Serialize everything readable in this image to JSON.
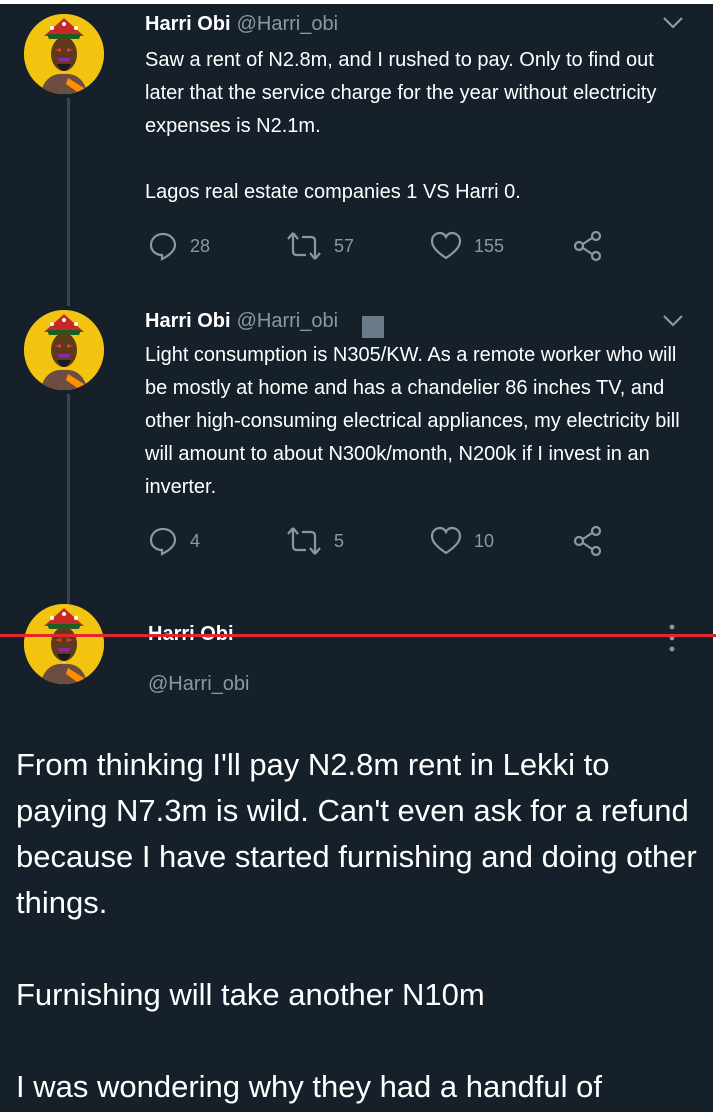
{
  "colors": {
    "background": "#15202b",
    "text": "#ffffff",
    "muted": "#8899a6",
    "thread_line": "#38444d",
    "avatar_bg": "#f2c410",
    "highlight_line": "#e0282e"
  },
  "tweets": [
    {
      "name": "Harri Obi",
      "handle": "@Harri_obi",
      "text": "Saw a rent of N2.8m, and I rushed to pay. Only to find out later that the service charge for the year without electricity expenses is N2.1m.\n\nLagos real estate companies 1 VS Harri 0.",
      "replies": "28",
      "retweets": "57",
      "likes": "155",
      "icons": [
        "chevron-down-icon",
        "reply-icon",
        "retweet-icon",
        "like-icon",
        "share-icon"
      ]
    },
    {
      "name": "Harri Obi",
      "handle": "@Harri_obi",
      "text": "Light consumption is N305/KW. As a remote worker who will be mostly at home and has a chandelier 86 inches TV, and other high-consuming electrical appliances, my electricity bill will amount to about N300k/month, N200k if I invest in an inverter.",
      "replies": "4",
      "retweets": "5",
      "likes": "10",
      "icons": [
        "chevron-down-icon",
        "reply-icon",
        "retweet-icon",
        "like-icon",
        "share-icon"
      ]
    }
  ],
  "main_tweet": {
    "name": "Harri Obi",
    "handle": "@Harri_obi",
    "paragraphs": [
      "From thinking I'll pay N2.8m rent in Lekki to paying N7.3m is wild. Can't even ask for a refund because I have started furnishing and doing other things.",
      "Furnishing will take another N10m",
      "I was wondering why they had a handful of celebrity tenants here. E don clear now."
    ],
    "icons": [
      "more-options-icon"
    ]
  }
}
